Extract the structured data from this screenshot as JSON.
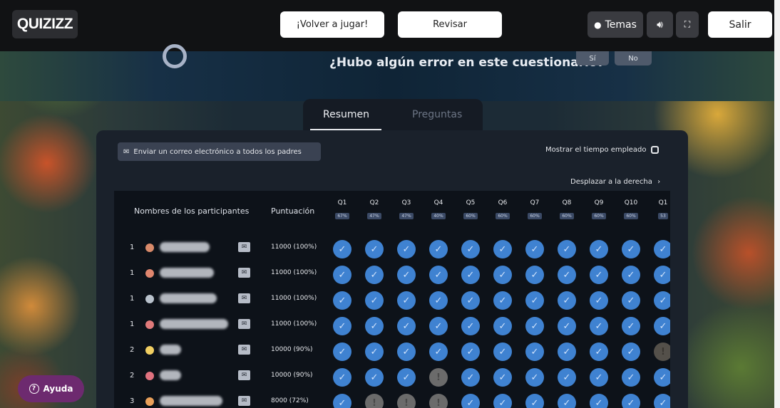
{
  "app": {
    "logo": "QUIZIZZ"
  },
  "topbar": {
    "play_again": "¡Volver a jugar!",
    "review": "Revisar",
    "themes": "Temas",
    "exit": "Salir"
  },
  "banner": {
    "question": "¿Hubo algún error en este cuestionario?",
    "yes": "Sí",
    "no": "No"
  },
  "tabs": [
    {
      "label": "Resumen",
      "active": true
    },
    {
      "label": "Preguntas",
      "active": false
    }
  ],
  "toolbar": {
    "email_parents": "Enviar un correo electrónico a todos los padres",
    "show_time": "Mostrar el tiempo empleado",
    "scroll_right": "Desplazar a la derecha"
  },
  "table": {
    "col_participants": "Nombres de los participantes",
    "col_score": "Puntuación",
    "questions": [
      {
        "label": "Q1",
        "pct": "67%"
      },
      {
        "label": "Q2",
        "pct": "47%"
      },
      {
        "label": "Q3",
        "pct": "47%"
      },
      {
        "label": "Q4",
        "pct": "40%"
      },
      {
        "label": "Q5",
        "pct": "60%"
      },
      {
        "label": "Q6",
        "pct": "60%"
      },
      {
        "label": "Q7",
        "pct": "60%"
      },
      {
        "label": "Q8",
        "pct": "60%"
      },
      {
        "label": "Q9",
        "pct": "60%"
      },
      {
        "label": "Q10",
        "pct": "60%"
      },
      {
        "label": "Q1",
        "pct": "53"
      }
    ],
    "rows": [
      {
        "rank": "1",
        "score": "11000 (100%)",
        "answers": [
          "c",
          "c",
          "c",
          "c",
          "c",
          "c",
          "c",
          "c",
          "c",
          "c",
          "c"
        ],
        "avatar_color": "#d98a6a"
      },
      {
        "rank": "1",
        "score": "11000 (100%)",
        "answers": [
          "c",
          "c",
          "c",
          "c",
          "c",
          "c",
          "c",
          "c",
          "c",
          "c",
          "c"
        ],
        "avatar_color": "#e0866e"
      },
      {
        "rank": "1",
        "score": "11000 (100%)",
        "answers": [
          "c",
          "c",
          "c",
          "c",
          "c",
          "c",
          "c",
          "c",
          "c",
          "c",
          "c"
        ],
        "avatar_color": "#b9c2cc"
      },
      {
        "rank": "1",
        "score": "11000 (100%)",
        "answers": [
          "c",
          "c",
          "c",
          "c",
          "c",
          "c",
          "c",
          "c",
          "c",
          "c",
          "c"
        ],
        "avatar_color": "#e07a7a"
      },
      {
        "rank": "2",
        "score": "10000 (90%)",
        "answers": [
          "c",
          "c",
          "c",
          "c",
          "c",
          "c",
          "c",
          "c",
          "c",
          "c",
          "p"
        ],
        "avatar_color": "#f1cf62"
      },
      {
        "rank": "2",
        "score": "10000 (90%)",
        "answers": [
          "c",
          "c",
          "c",
          "w",
          "c",
          "c",
          "c",
          "c",
          "c",
          "c",
          "c"
        ],
        "avatar_color": "#e0727f"
      },
      {
        "rank": "3",
        "score": "8000 (72%)",
        "answers": [
          "c",
          "w",
          "w",
          "w",
          "c",
          "c",
          "c",
          "c",
          "c",
          "c",
          "c"
        ],
        "avatar_color": "#e9a05a"
      }
    ]
  },
  "help": {
    "label": "Ayuda"
  }
}
